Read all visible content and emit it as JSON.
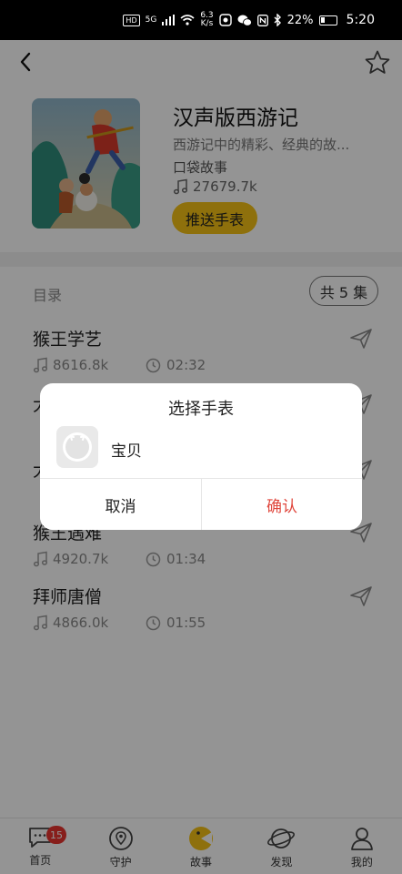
{
  "status_bar": {
    "hd": "HD",
    "net_label": "5G",
    "speed_value": "6.3",
    "speed_unit": "K/s",
    "battery_percent": "22%",
    "time": "5:20"
  },
  "album": {
    "title": "汉声版西游记",
    "description": "西游记中的精彩、经典的故...",
    "category": "口袋故事",
    "plays": "27679.7k",
    "push_button": "推送手表"
  },
  "catalog": {
    "label": "目录",
    "count": "共 5 集",
    "episodes": [
      {
        "title": "猴王学艺",
        "plays": "8616.8k",
        "duration": "02:32"
      },
      {
        "title": "大",
        "plays": "",
        "duration": ""
      },
      {
        "title": "大",
        "plays": "",
        "duration": ""
      },
      {
        "title": "猴王遇难",
        "plays": "4920.7k",
        "duration": "01:34"
      },
      {
        "title": "拜师唐僧",
        "plays": "4866.0k",
        "duration": "01:55"
      }
    ]
  },
  "bottom_nav": {
    "items": [
      {
        "label": "首页",
        "icon": "message-icon",
        "badge": "15"
      },
      {
        "label": "守护",
        "icon": "location-pin-icon"
      },
      {
        "label": "故事",
        "icon": "story-icon",
        "active": true
      },
      {
        "label": "发现",
        "icon": "planet-icon"
      },
      {
        "label": "我的",
        "icon": "person-icon"
      }
    ]
  },
  "dialog": {
    "title": "选择手表",
    "watch_name": "宝贝",
    "cancel": "取消",
    "confirm": "确认"
  },
  "colors": {
    "accent_yellow": "#f5c216",
    "confirm_red": "#e0473d",
    "badge_red": "#e8342f",
    "overlay": "rgba(0,0,0,0.42)"
  }
}
